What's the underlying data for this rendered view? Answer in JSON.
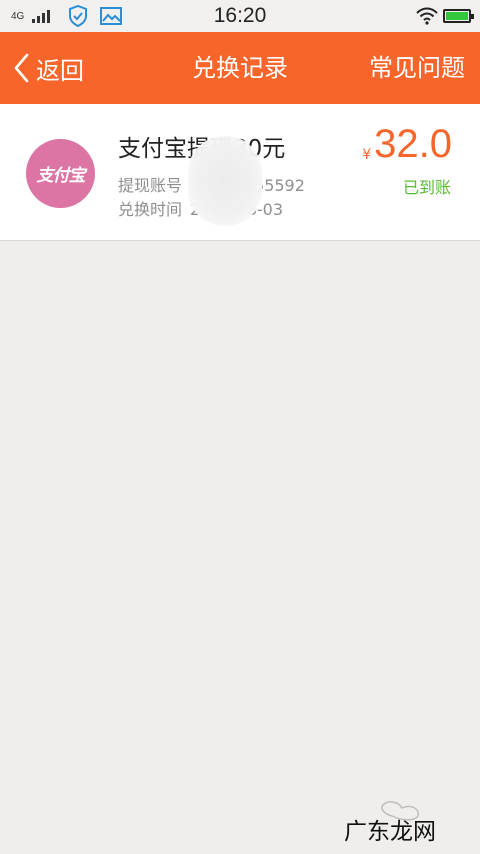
{
  "status_bar": {
    "network": "4G",
    "time": "16:20",
    "battery_color": "#32c83c"
  },
  "header": {
    "back_label": "返回",
    "title": "兑换记录",
    "faq_label": "常见问题",
    "bg_color": "#f7652b"
  },
  "record": {
    "logo_text": "支付宝",
    "title": "支付宝提现30元",
    "account_label": "提现账号",
    "account_value": "55592",
    "time_label": "兑换时间",
    "time_value": "2016-08-03",
    "currency": "¥",
    "amount": "32.0",
    "status": "已到账",
    "status_color": "#5cb937"
  },
  "watermark": {
    "text": "广东龙网"
  }
}
